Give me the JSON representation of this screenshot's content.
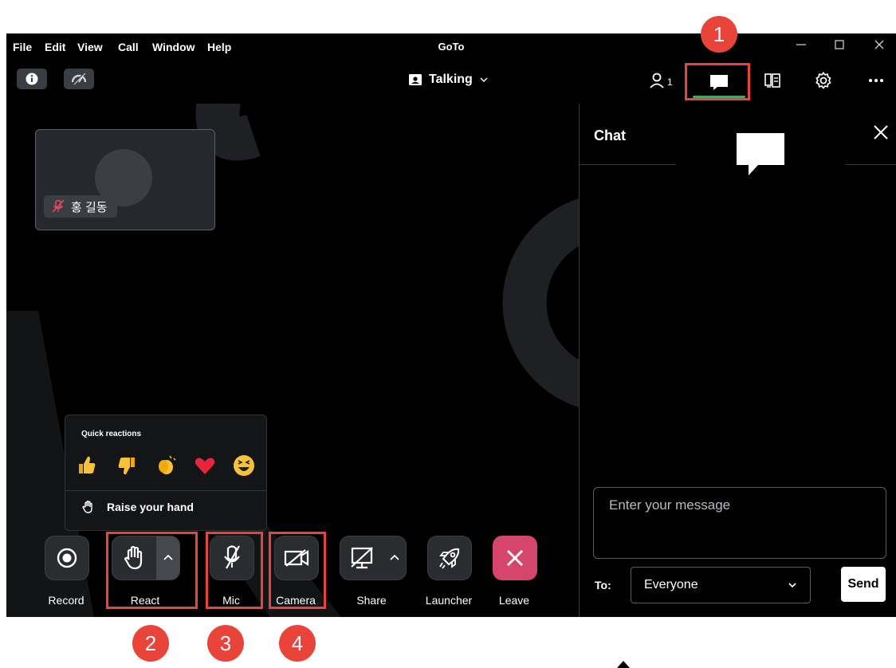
{
  "app": {
    "title": "GoTo",
    "menu": [
      "File",
      "Edit",
      "View",
      "Call",
      "Window",
      "Help"
    ]
  },
  "toolbar": {
    "status_label": "Talking",
    "participants_count": "1"
  },
  "stage": {
    "participant_name": "홍 길동",
    "reactions_title": "Quick reactions",
    "reactions": [
      "thumbs-up",
      "thumbs-down",
      "clapping-hands",
      "heart",
      "laughing-face"
    ],
    "raise_hand_label": "Raise your hand"
  },
  "controls": {
    "record": "Record",
    "react": "React",
    "mic": "Mic",
    "camera": "Camera",
    "share": "Share",
    "launcher": "Launcher",
    "leave": "Leave"
  },
  "chat": {
    "title": "Chat",
    "message_placeholder": "Enter your message",
    "to_label": "To:",
    "recipient": "Everyone",
    "send_label": "Send"
  },
  "callouts": [
    "1",
    "2",
    "3",
    "4"
  ],
  "colors": {
    "callout": "#e8443a",
    "leave_button": "#d6456b",
    "active_tab_underline": "#3ea86b"
  }
}
